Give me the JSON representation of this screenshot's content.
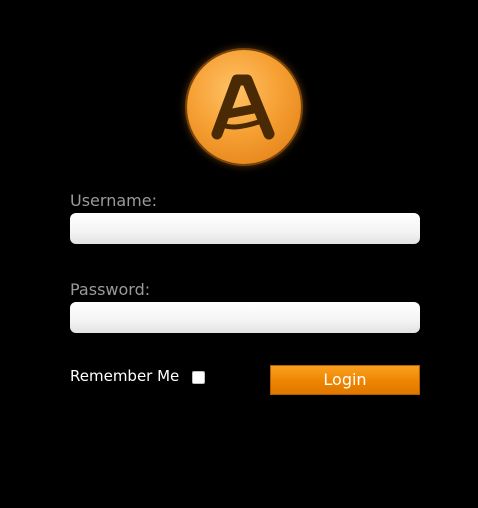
{
  "logo": {
    "icon": "app-logo-icon",
    "letter": "A",
    "color": "#f6a034"
  },
  "form": {
    "username_label": "Username:",
    "username_value": "",
    "password_label": "Password:",
    "password_value": "",
    "remember_label": "Remember Me",
    "remember_checked": false,
    "login_label": "Login"
  },
  "colors": {
    "background": "#000000",
    "accent": "#ee8500",
    "label": "#9a9a9a"
  }
}
